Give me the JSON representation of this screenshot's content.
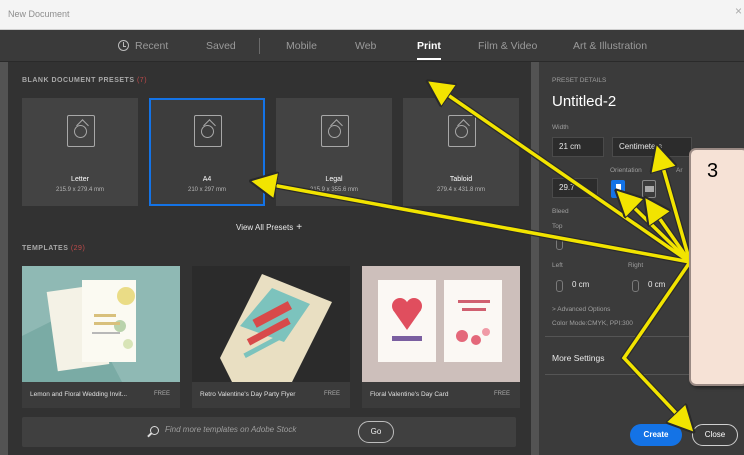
{
  "window": {
    "title": "New Document",
    "close_glyph": "×"
  },
  "tabs": [
    {
      "label": "Recent",
      "icon": "clock-icon"
    },
    {
      "label": "Saved"
    },
    {
      "label": "Mobile"
    },
    {
      "label": "Web"
    },
    {
      "label": "Print",
      "active": true
    },
    {
      "label": "Film & Video"
    },
    {
      "label": "Art & Illustration"
    }
  ],
  "presets_section": {
    "heading": "BLANK DOCUMENT PRESETS",
    "count": "(7)"
  },
  "presets": [
    {
      "name": "Letter",
      "size": "215.9 x 279.4 mm"
    },
    {
      "name": "A4",
      "size": "210 x 297 mm",
      "selected": true
    },
    {
      "name": "Legal",
      "size": "215.9 x 355.6 mm"
    },
    {
      "name": "Tabloid",
      "size": "279.4 x 431.8 mm"
    }
  ],
  "view_all": {
    "label": "View All Presets",
    "icon": "plus-icon",
    "glyph": "+"
  },
  "templates_section": {
    "heading": "TEMPLATES",
    "count": "(29)"
  },
  "templates": [
    {
      "name": "Lemon and Floral Wedding Invit...",
      "badge": "FREE"
    },
    {
      "name": "Retro Valentine's Day Party Flyer",
      "badge": "FREE"
    },
    {
      "name": "Floral Valentine's Day Card",
      "badge": "FREE"
    }
  ],
  "search": {
    "placeholder": "Find more templates on Adobe Stock",
    "go_label": "Go"
  },
  "details": {
    "heading": "PRESET DETAILS",
    "name": "Untitled-2",
    "width_label": "Width",
    "width_value": "21 cm",
    "units_value": "Centimeters",
    "height_value": "29.7",
    "orientation_label": "Orientation",
    "artboards_label": "Ar",
    "bleed_label": "Bleed",
    "top_label": "Top",
    "left_label": "Left",
    "right_label": "Right",
    "left_value": "0 cm",
    "right_value": "0 cm",
    "advanced_label": "> Advanced Options",
    "color_mode": "Color Mode:CMYK, PPI:300",
    "more_settings_label": "More Settings",
    "create_label": "Create",
    "close_label": "Close"
  },
  "callout": {
    "number": "3"
  },
  "colors": {
    "accent": "#1473e6",
    "arrow": "#f2e400",
    "callout_bg": "#f6e2d6",
    "panel": "#323232"
  }
}
